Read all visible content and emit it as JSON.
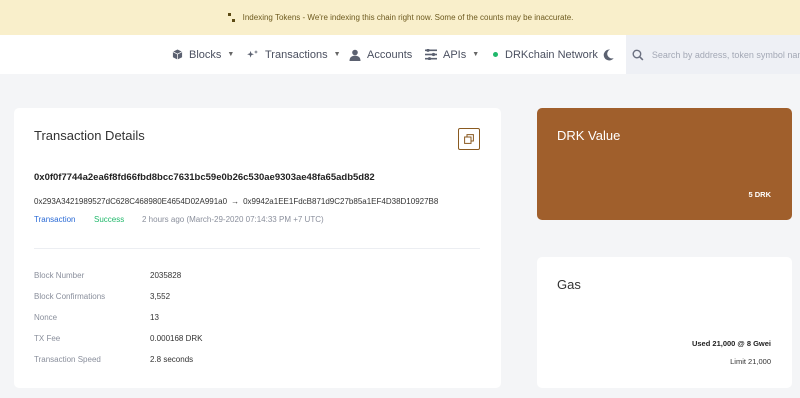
{
  "banner": {
    "text": "Indexing Tokens - We're indexing this chain right now. Some of the counts may be inaccurate."
  },
  "nav": {
    "blocks": "Blocks",
    "transactions": "Transactions",
    "accounts": "Accounts",
    "apis": "APIs",
    "network": "DRKchain Network",
    "search_placeholder": "Search by address, token symbol name, transaction hash, or block number"
  },
  "transaction": {
    "title": "Transaction Details",
    "hash": "0x0f0f7744a2ea6f8fd66fbd8bcc7631bc59e0b26c530ae9303ae48fa65adb5d82",
    "from": "0x293A3421989527dC628C468980E4654D02A991a0",
    "arrow": "→",
    "to": "0x9942a1EE1FdcB871d9C27b85a1EF4D38D10927B8",
    "type": "Transaction",
    "status": "Success",
    "time": "2 hours ago (March-29-2020 07:14:33 PM +7 UTC)",
    "details": [
      {
        "label": "Block Number",
        "value": "2035828"
      },
      {
        "label": "Block Confirmations",
        "value": "3,552"
      },
      {
        "label": "Nonce",
        "value": "13"
      },
      {
        "label": "TX Fee",
        "value": "0.000168 DRK"
      },
      {
        "label": "Transaction Speed",
        "value": "2.8 seconds"
      }
    ]
  },
  "drk_value": {
    "title": "DRK Value",
    "value": "5 DRK"
  },
  "gas": {
    "title": "Gas",
    "used": "Used 21,000 @ 8 Gwei",
    "limit": "Limit 21,000"
  },
  "colors": {
    "banner_bg": "#f9efcb",
    "accent_brown": "#a05f2c",
    "success_green": "#20b86b",
    "link_blue": "#2b6bd6"
  },
  "icons": [
    "loader-icon",
    "cube-icon",
    "transactions-icon",
    "user-icon",
    "api-icon",
    "moon-icon",
    "search-icon",
    "copy-icon"
  ]
}
